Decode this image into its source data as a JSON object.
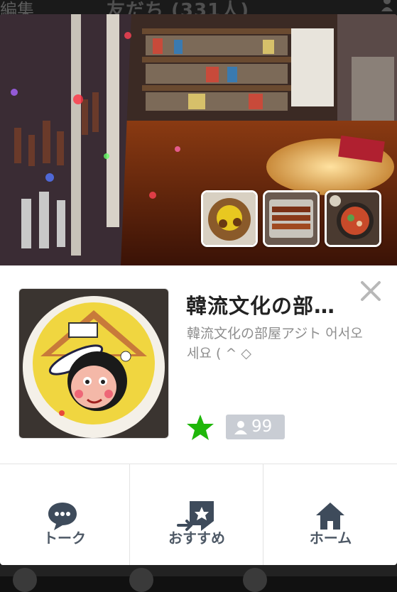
{
  "background": {
    "edit_label": "編集",
    "title": "友だち (331人)"
  },
  "profile": {
    "name": "韓流文化の部屋アジト",
    "status_message": "韓流文化の部屋アジト 어서오세요 ( ^ ◇",
    "favorite": true,
    "member_count": "99"
  },
  "icons": {
    "close": "close-icon",
    "favorite": "star-icon",
    "members": "person-icon",
    "talk": "chat-bubble-icon",
    "recommend": "share-arrow-icon",
    "home": "home-icon"
  },
  "colors": {
    "star": "#1fb70a",
    "badge": "#c9cdd4",
    "action_icon": "#3e4b5b"
  },
  "actions": [
    {
      "id": "talk",
      "label": "トーク"
    },
    {
      "id": "recommend",
      "label": "おすすめ"
    },
    {
      "id": "home",
      "label": "ホーム"
    }
  ],
  "photos": [
    {
      "name": "food-photo-1"
    },
    {
      "name": "food-photo-2"
    },
    {
      "name": "food-photo-3"
    }
  ]
}
